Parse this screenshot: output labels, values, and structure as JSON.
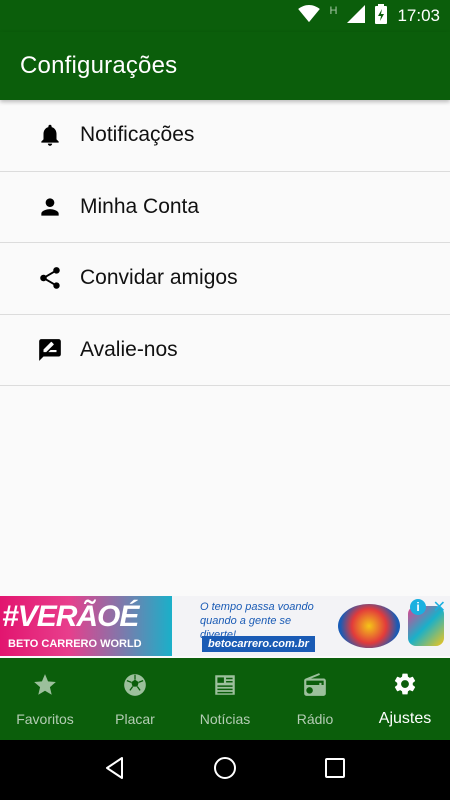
{
  "status_bar": {
    "time": "17:03",
    "network_letter": "H",
    "icons": [
      "wifi-icon",
      "signal-icon",
      "battery-charging-icon"
    ]
  },
  "app_bar": {
    "title": "Configurações"
  },
  "settings": {
    "items": [
      {
        "label": "Notificações",
        "icon": "bell-icon"
      },
      {
        "label": "Minha Conta",
        "icon": "person-icon"
      },
      {
        "label": "Convidar amigos",
        "icon": "share-icon"
      },
      {
        "label": "Avalie-nos",
        "icon": "rate-review-icon"
      }
    ]
  },
  "ad": {
    "hashtag": "#VERÃOÉ",
    "brand": "BETO CARRERO WORLD",
    "tagline": "O tempo passa voando quando a gente se diverte!",
    "url": "betocarrero.com.br",
    "info_symbol": "i",
    "close_symbol": "✕"
  },
  "bottom_nav": {
    "items": [
      {
        "label": "Favoritos",
        "icon": "star-icon",
        "active": false
      },
      {
        "label": "Placar",
        "icon": "soccer-ball-icon",
        "active": false
      },
      {
        "label": "Notícias",
        "icon": "newspaper-icon",
        "active": false
      },
      {
        "label": "Rádio",
        "icon": "radio-icon",
        "active": false
      },
      {
        "label": "Ajustes",
        "icon": "gear-icon",
        "active": true
      }
    ]
  },
  "system_nav": {
    "buttons": [
      "back-icon",
      "home-icon",
      "recents-icon"
    ]
  },
  "colors": {
    "primary": "#0b5e0b",
    "background": "#fafafa",
    "nav_inactive": "#b4cdb4",
    "nav_active": "#ffffff"
  }
}
